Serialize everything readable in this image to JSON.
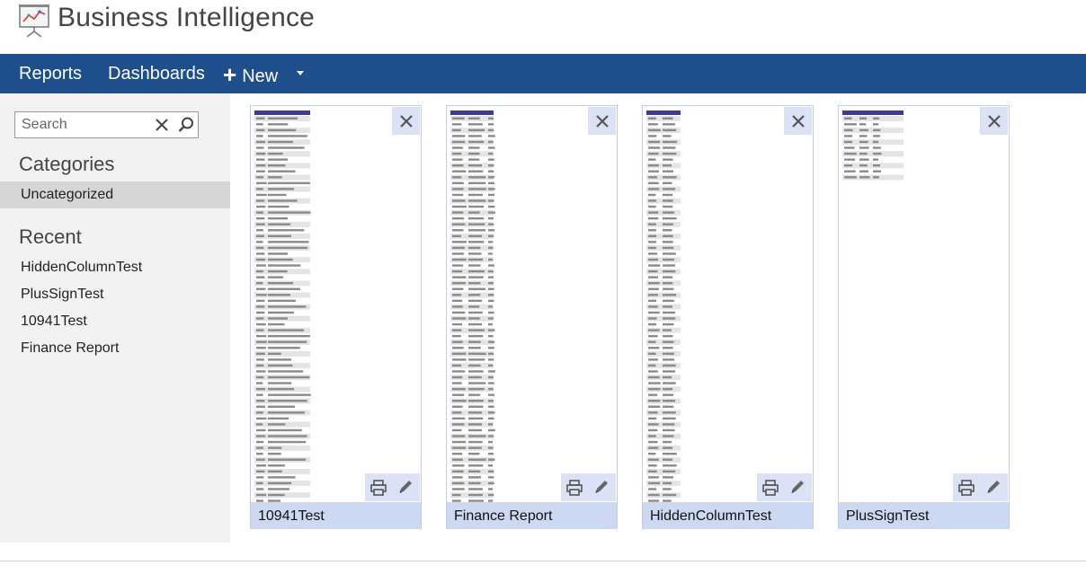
{
  "app": {
    "title": "Business Intelligence"
  },
  "nav": {
    "reports_label": "Reports",
    "dashboards_label": "Dashboards",
    "new_label": "New",
    "new_icon": "plus-icon",
    "dropdown_icon": "caret-down-icon"
  },
  "sidebar": {
    "search_placeholder": "Search",
    "search_value": "",
    "categories_heading": "Categories",
    "categories": [
      {
        "label": "Uncategorized",
        "selected": true
      }
    ],
    "recent_heading": "Recent",
    "recent": [
      {
        "label": "HiddenColumnTest"
      },
      {
        "label": "PlusSignTest"
      },
      {
        "label": "10941Test"
      },
      {
        "label": "Finance Report"
      }
    ]
  },
  "reports": [
    {
      "title": "10941Test",
      "preview": "long-list"
    },
    {
      "title": "Finance Report",
      "preview": "numeric-list"
    },
    {
      "title": "HiddenColumnTest",
      "preview": "date-list"
    },
    {
      "title": "PlusSignTest",
      "preview": "short-table"
    }
  ],
  "colors": {
    "nav_background": "#1e4e8c",
    "sidebar_background": "#f2f2f2",
    "selected_category": "#d6d6d6",
    "card_title_bar": "#cdd8f2",
    "card_tool_background": "#dbe2f5",
    "preview_header": "#3c3c8a"
  }
}
